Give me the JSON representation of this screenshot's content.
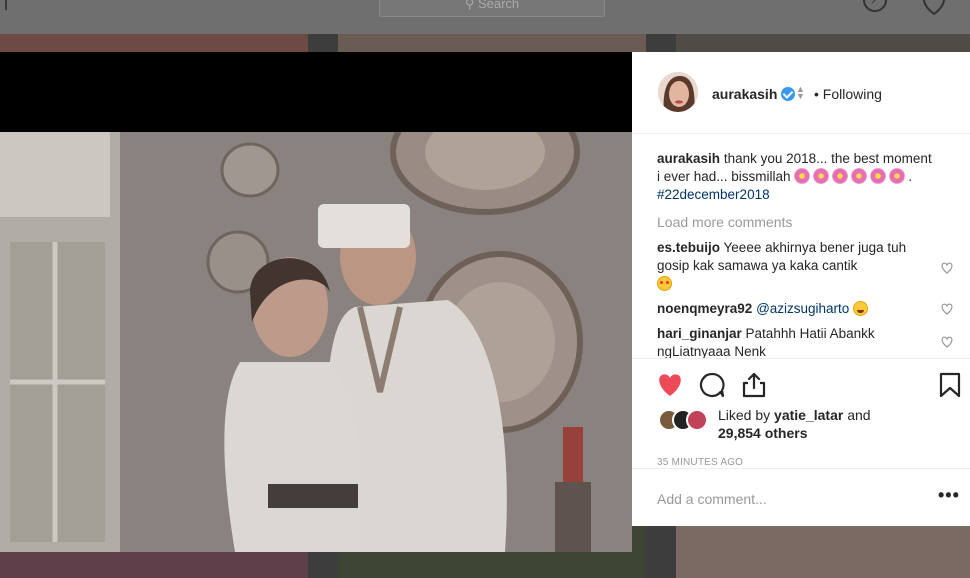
{
  "search": {
    "placeholder": "Search"
  },
  "post": {
    "username": "aurakasih",
    "follow_state": "• Following",
    "caption": {
      "username": "aurakasih",
      "text": "thank you 2018... the best moment i ever had... bissmillah",
      "hashtag": "#22december2018"
    },
    "load_more_label": "Load more comments",
    "comments": [
      {
        "username": "es.tebuijo",
        "text": "Yeeee akhirnya bener juga tuh gosip kak samawa ya kaka cantik"
      },
      {
        "username": "noenqmeyra92",
        "mention": "@azizsugiharto"
      },
      {
        "username": "hari_ginanjar",
        "text": "Patahhh Hatii Abankk ngLiatnyaaa Nenk"
      }
    ],
    "likes": {
      "prefix": "Liked by",
      "liker": "yatie_latar",
      "and": "and",
      "others": "29,854 others"
    },
    "time_ago": "35 MINUTES AGO",
    "add_comment_placeholder": "Add a comment...",
    "more_label": "•••"
  },
  "colors": {
    "like_red": "#ed4956",
    "link_blue": "#003569",
    "verified_blue": "#3897f0",
    "muted_gray": "#999999"
  },
  "icons": [
    "compass-icon",
    "heart-icon",
    "search-icon",
    "verified-badge-icon",
    "like-heart-icon",
    "comment-icon",
    "share-icon",
    "bookmark-icon",
    "more-options-icon"
  ]
}
